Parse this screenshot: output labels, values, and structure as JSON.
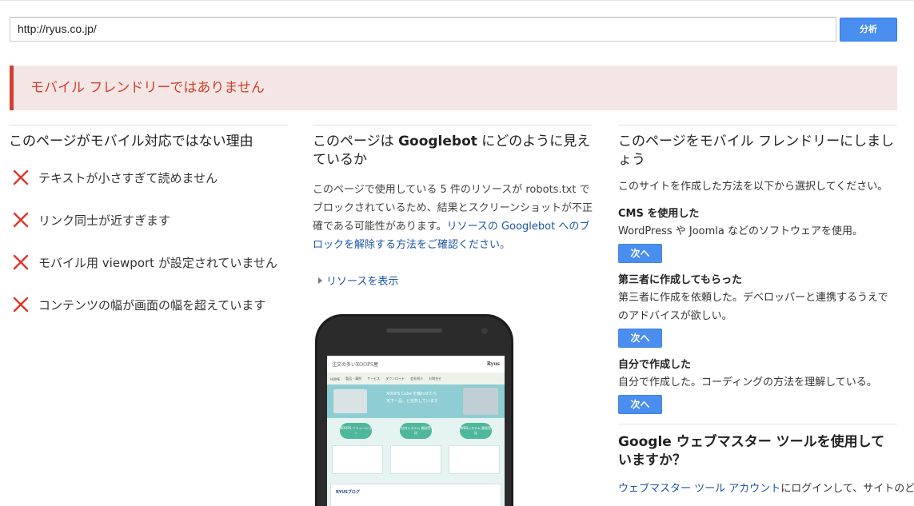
{
  "url_bar": {
    "value": "http://ryus.co.jp/"
  },
  "analyze_button": {
    "label": "分析"
  },
  "banner": {
    "text": "モバイル フレンドリーではありません"
  },
  "reasons_column": {
    "title": "このページがモバイル対応ではない理由",
    "items": [
      {
        "icon": "red-x-icon",
        "text": "テキストが小さすぎて読めません"
      },
      {
        "icon": "red-x-icon",
        "text": "リンク同士が近すぎます"
      },
      {
        "icon": "red-x-icon",
        "text": "モバイル用 viewport が設定されていません"
      },
      {
        "icon": "red-x-icon",
        "text": "コンテンツの幅が画面の幅を超えています"
      }
    ]
  },
  "googlebot_column": {
    "title_prefix": "このページは",
    "title_bold": "Googlebot",
    "title_suffix": "にどのように見えているか",
    "desc_plain": "このページで使用している 5 件のリソースが robots.txt でブロックされているため、結果とスクリーンショットが不正確である可能性があります。",
    "desc_link": "リソースの Googlebot へのブロックを解除する方法をご確認ください。",
    "show_resources": "リソースを表示",
    "preview": {
      "site_title": "注文の多いXOOPS屋",
      "site_logo": "Ryus",
      "nav": [
        "HOME",
        "製品・事例",
        "サービス",
        "ダウンロード",
        "会社紹介",
        "お問合せ"
      ],
      "hero_text_1": "XOOPS Cube を触わせたら",
      "hero_text_2": "天下一品、と自負しています",
      "bubbles": [
        "XOOPS ソリューション",
        "社内システム 開発受託",
        "WEBシステム 開発受託"
      ],
      "footer_label": "RYUSブログ"
    }
  },
  "fix_column": {
    "title": "このページをモバイル フレンドリーにしましょう",
    "intro": "このサイトを作成した方法を以下から選択してください。",
    "options": [
      {
        "heading": "CMS を使用した",
        "desc": "WordPress や Joomla などのソフトウェアを使用。",
        "button": "次へ"
      },
      {
        "heading": "第三者に作成してもらった",
        "desc": "第三者に作成を依頼した。デベロッパーと連携するうえでのアドバイスが欲しい。",
        "button": "次へ"
      },
      {
        "heading": "自分で作成した",
        "desc": "自分で作成した。コーディングの方法を理解している。",
        "button": "次へ"
      }
    ],
    "gwt_title": "Google ウェブマスター ツールを使用していますか？",
    "gwt_link": "ウェブマスター ツール アカウント",
    "gwt_rest": "にログインして、サイトのど"
  },
  "colors": {
    "accent_blue": "#4a8ef0",
    "error_red": "#d23f31",
    "banner_bg": "#f4e6e4",
    "link_blue": "#1a55a8"
  }
}
